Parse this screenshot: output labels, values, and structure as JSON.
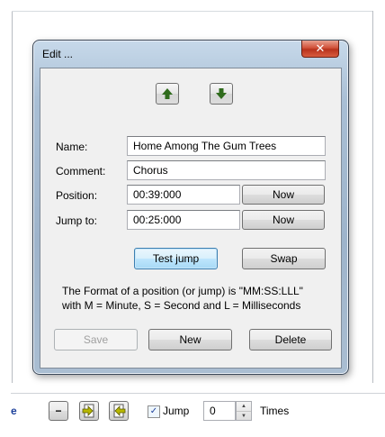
{
  "dialog": {
    "title": "Edit ...",
    "close_glyph": "✕",
    "move_up_icon": "up-arrow-icon",
    "move_down_icon": "down-arrow-icon",
    "name_label": "Name:",
    "name_value": "Home Among The Gum Trees",
    "comment_label": "Comment:",
    "comment_value": "Chorus",
    "position_label": "Position:",
    "position_value": "00:39:000",
    "position_now_label": "Now",
    "jump_label": "Jump to:",
    "jump_value": "00:25:000",
    "jump_now_label": "Now",
    "test_jump_label": "Test jump",
    "swap_label": "Swap",
    "format_line1": "The Format of a position (or jump) is \"MM:SS:LLL\"",
    "format_line2": "with M = Minute, S = Second and L = Milliseconds",
    "save_label": "Save",
    "new_label": "New",
    "delete_label": "Delete"
  },
  "toolbar": {
    "partial_label": "e",
    "minus_glyph": "−",
    "jump_checked": true,
    "jump_label": "Jump",
    "times_value": "0",
    "times_label": "Times"
  },
  "colors": {
    "accent": "#3c7fb1",
    "close": "#c8452c",
    "arrow_icon": "#2f6b1c"
  }
}
